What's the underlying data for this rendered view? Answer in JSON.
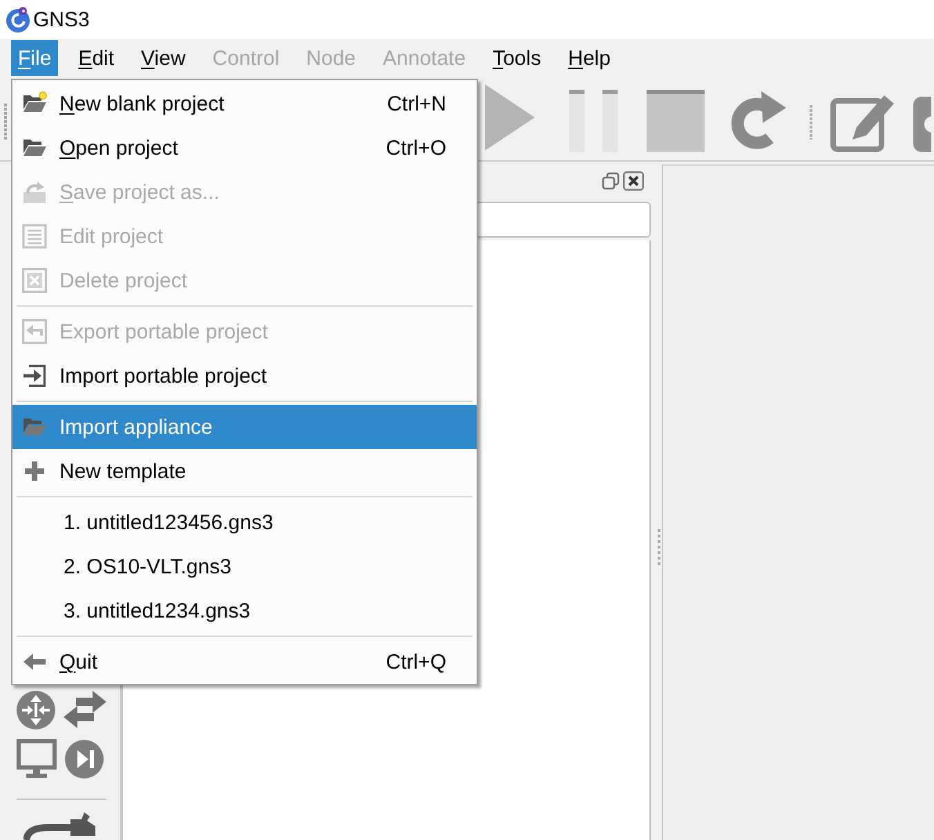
{
  "window": {
    "title": "GNS3"
  },
  "menu_bar": [
    {
      "label": "File",
      "selected": true,
      "disabled": false,
      "mnemonic": true
    },
    {
      "label": "Edit",
      "selected": false,
      "disabled": false,
      "mnemonic": true
    },
    {
      "label": "View",
      "selected": false,
      "disabled": false,
      "mnemonic": true
    },
    {
      "label": "Control",
      "selected": false,
      "disabled": true,
      "mnemonic": false
    },
    {
      "label": "Node",
      "selected": false,
      "disabled": true,
      "mnemonic": false
    },
    {
      "label": "Annotate",
      "selected": false,
      "disabled": true,
      "mnemonic": false
    },
    {
      "label": "Tools",
      "selected": false,
      "disabled": false,
      "mnemonic": true
    },
    {
      "label": "Help",
      "selected": false,
      "disabled": false,
      "mnemonic": true
    }
  ],
  "file_menu": {
    "items": [
      {
        "kind": "action",
        "label": "New blank project",
        "shortcut": "Ctrl+N",
        "disabled": false,
        "selected": false,
        "mnemonic": true
      },
      {
        "kind": "action",
        "label": "Open project",
        "shortcut": "Ctrl+O",
        "disabled": false,
        "selected": false,
        "mnemonic": true
      },
      {
        "kind": "action",
        "label": "Save project as...",
        "disabled": true,
        "selected": false,
        "mnemonic": true
      },
      {
        "kind": "action",
        "label": "Edit project",
        "disabled": true,
        "selected": false,
        "mnemonic": false
      },
      {
        "kind": "action",
        "label": "Delete project",
        "disabled": true,
        "selected": false,
        "mnemonic": false
      },
      {
        "kind": "separator"
      },
      {
        "kind": "action",
        "label": "Export portable project",
        "disabled": true,
        "selected": false,
        "mnemonic": false
      },
      {
        "kind": "action",
        "label": "Import portable project",
        "disabled": false,
        "selected": false,
        "mnemonic": false
      },
      {
        "kind": "separator"
      },
      {
        "kind": "action",
        "label": "Import appliance",
        "disabled": false,
        "selected": true,
        "mnemonic": false
      },
      {
        "kind": "action",
        "label": "New template",
        "disabled": false,
        "selected": false,
        "mnemonic": false
      },
      {
        "kind": "separator"
      },
      {
        "kind": "recent",
        "label": "1. untitled123456.gns3",
        "disabled": false,
        "selected": false,
        "mnemonic": false
      },
      {
        "kind": "recent",
        "label": "2. OS10-VLT.gns3",
        "disabled": false,
        "selected": false,
        "mnemonic": false
      },
      {
        "kind": "recent",
        "label": "3. untitled1234.gns3",
        "disabled": false,
        "selected": false,
        "mnemonic": false
      },
      {
        "kind": "separator"
      },
      {
        "kind": "action",
        "label": "Quit",
        "shortcut": "Ctrl+Q",
        "disabled": false,
        "selected": false,
        "mnemonic": true
      }
    ]
  }
}
